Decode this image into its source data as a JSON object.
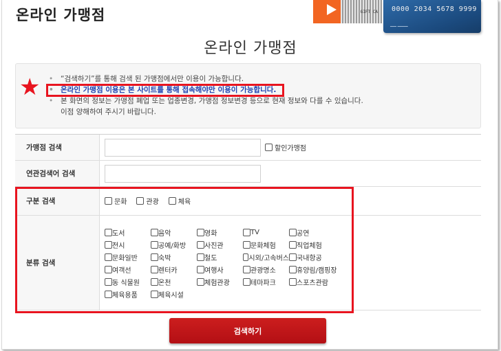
{
  "header": {
    "title": "온라인 가맹점"
  },
  "banner": {
    "card_number": "0000 2034 5678 9999",
    "ticket_tag": "GIFT CA"
  },
  "page_title": "온라인 가맹점",
  "notice": {
    "lines": [
      "“검색하기”를 통해 검색 된 가맹점에서만 이용이 가능합니다.",
      "온라인 가맹점 이용은 본 사이트를 통해 접속해야만 이용이 가능합니다.",
      "본 화면의 정보는 가맹점 폐업 또는 업종변경, 가맹점 정보변경 등으로 현재 정보와 다를 수 있습니다.",
      "이점 양해하여 주시기 바랍니다."
    ],
    "bullet": "•",
    "star": "★"
  },
  "form": {
    "store_search_label": "가맹점 검색",
    "store_search_value": "",
    "discount_label": "할인가맹점",
    "related_search_label": "연관검색어 검색",
    "related_search_value": "",
    "division_label": "구분 검색",
    "divisions": [
      "문화",
      "관광",
      "체육"
    ],
    "category_label": "분류 검색",
    "categories": [
      "도서",
      "음악",
      "영화",
      "TV",
      "공연",
      "전시",
      "공예/화방",
      "사진관",
      "문화체험",
      "직업체험",
      "문화일반",
      "숙박",
      "철도",
      "시외/고속버스",
      "국내항공",
      "여객선",
      "렌터카",
      "여행사",
      "관광명소",
      "휴양림/캠핑장",
      "동 식물원",
      "온천",
      "체험관광",
      "테마파크",
      "스포츠관람",
      "체육용품",
      "체육시설"
    ]
  },
  "search_button": "검색하기",
  "colors": {
    "accent_red": "#e8141f",
    "button_red": "#c0161b",
    "highlight_blue": "#1b3fb0"
  }
}
